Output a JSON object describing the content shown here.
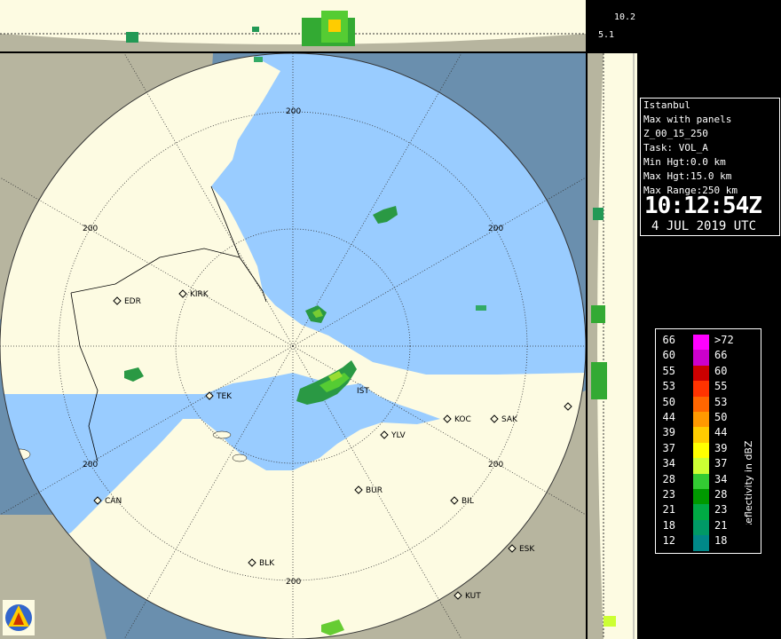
{
  "radar": {
    "name": "Istanbul",
    "product": "Max with panels",
    "product_code": "Z_00_15_250",
    "task": "Task: VOL_A",
    "min_height": "Min Hgt:0.0 km",
    "max_height": "Max Hgt:15.0 km",
    "max_range": "Max Range:250 km",
    "time": "10:12:54Z",
    "date": "4 JUL 2019 UTC"
  },
  "height_scale": {
    "upper": "10.2",
    "lower": "5.1"
  },
  "range_ring_label": "200",
  "sites": [
    {
      "code": "EDR"
    },
    {
      "code": "KIRK"
    },
    {
      "code": "TEK"
    },
    {
      "code": "IST"
    },
    {
      "code": "KOC"
    },
    {
      "code": "SAK"
    },
    {
      "code": "YLV"
    },
    {
      "code": "CAN"
    },
    {
      "code": "BUR"
    },
    {
      "code": "BIL"
    },
    {
      "code": "BLK"
    },
    {
      "code": "ESK"
    },
    {
      "code": "KUT"
    }
  ],
  "legend": {
    "title": "Reflectivity in dBZ",
    "rows": [
      {
        "lo": "66",
        "hi": ">72",
        "color": "#ff00ff"
      },
      {
        "lo": "60",
        "hi": "66",
        "color": "#cc00cc"
      },
      {
        "lo": "55",
        "hi": "60",
        "color": "#cc0000"
      },
      {
        "lo": "53",
        "hi": "55",
        "color": "#ff3300"
      },
      {
        "lo": "50",
        "hi": "53",
        "color": "#ff6600"
      },
      {
        "lo": "44",
        "hi": "50",
        "color": "#ff9900"
      },
      {
        "lo": "39",
        "hi": "44",
        "color": "#ffcc00"
      },
      {
        "lo": "37",
        "hi": "39",
        "color": "#ffff00"
      },
      {
        "lo": "34",
        "hi": "37",
        "color": "#ccff33"
      },
      {
        "lo": "28",
        "hi": "34",
        "color": "#33cc33"
      },
      {
        "lo": "23",
        "hi": "28",
        "color": "#009900"
      },
      {
        "lo": "21",
        "hi": "23",
        "color": "#00aa44"
      },
      {
        "lo": "18",
        "hi": "21",
        "color": "#009966"
      },
      {
        "lo": "12",
        "hi": "18",
        "color": "#008888"
      }
    ]
  },
  "colors": {
    "land": "#fdfbe2",
    "sea": "#99ccff",
    "outside_land": "#b7b59f",
    "outside_sea": "#6a8fae"
  },
  "icons": {
    "logo": "mgm-logo-icon",
    "site_marker": "diamond-icon"
  }
}
